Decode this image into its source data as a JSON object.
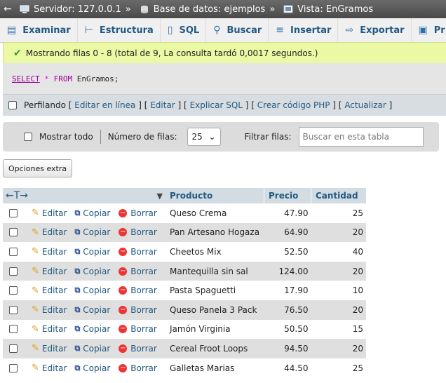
{
  "breadcrumb": {
    "server_label": "Servidor: 127.0.0.1",
    "database_label": "Base de datos: ejemplos",
    "view_label": "Vista: EnGramos"
  },
  "tabs": [
    {
      "label": "Examinar",
      "icon": "table-icon"
    },
    {
      "label": "Estructura",
      "icon": "structure-icon"
    },
    {
      "label": "SQL",
      "icon": "sql-icon"
    },
    {
      "label": "Buscar",
      "icon": "search-icon"
    },
    {
      "label": "Insertar",
      "icon": "insert-icon"
    },
    {
      "label": "Exportar",
      "icon": "export-icon"
    },
    {
      "label": "Pr",
      "icon": "privileges-icon"
    }
  ],
  "success_message": "Mostrando filas 0 - 8 (total de 9, La consulta tardó 0,0017 segundos.)",
  "sql": {
    "select": "SELECT",
    "star": "*",
    "from": "FROM",
    "rest": "EnGramos;"
  },
  "toolbar": {
    "profiling": "Perfilando",
    "edit_inline": "Editar en línea",
    "edit": "Editar",
    "explain": "Explicar SQL",
    "php": "Crear código PHP",
    "refresh": "Actualizar"
  },
  "nav": {
    "show_all": "Mostrar todo",
    "rows_label": "Número de filas:",
    "rows_value": "25",
    "filter_label": "Filtrar filas:",
    "filter_placeholder": "Buscar en esta tabla"
  },
  "extra_options": "Opciones extra",
  "table": {
    "columns": [
      "Producto",
      "Precio",
      "Cantidad"
    ],
    "actions": {
      "edit": "Editar",
      "copy": "Copiar",
      "delete": "Borrar"
    },
    "rows": [
      {
        "producto": "Queso Crema",
        "precio": "47.90",
        "cantidad": "25"
      },
      {
        "producto": "Pan Artesano Hogaza",
        "precio": "64.90",
        "cantidad": "20"
      },
      {
        "producto": "Cheetos Mix",
        "precio": "52.50",
        "cantidad": "40"
      },
      {
        "producto": "Mantequilla sin sal",
        "precio": "124.00",
        "cantidad": "20"
      },
      {
        "producto": "Pasta Spaguetti",
        "precio": "17.90",
        "cantidad": "10"
      },
      {
        "producto": "Queso Panela 3 Pack",
        "precio": "76.50",
        "cantidad": "20"
      },
      {
        "producto": "Jamón Virginia",
        "precio": "50.50",
        "cantidad": "15"
      },
      {
        "producto": "Cereal Froot Loops",
        "precio": "94.50",
        "cantidad": "20"
      },
      {
        "producto": "Galletas Marias",
        "precio": "44.50",
        "cantidad": "25"
      }
    ]
  }
}
